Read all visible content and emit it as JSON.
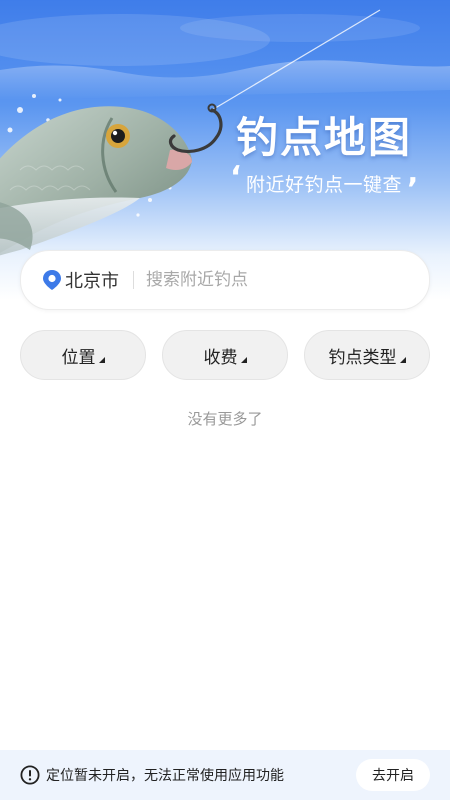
{
  "hero": {
    "title": "钓点地图",
    "subtitle": "附近好钓点一键查",
    "quote_open": "‘",
    "quote_close": "’"
  },
  "search": {
    "city": "北京市",
    "placeholder": "搜索附近钓点",
    "location_icon": "location-pin-icon"
  },
  "filters": [
    {
      "label": "位置"
    },
    {
      "label": "收费"
    },
    {
      "label": "钓点类型"
    }
  ],
  "list": {
    "empty_text": "没有更多了"
  },
  "notice": {
    "text": "定位暂未开启，无法正常使用应用功能",
    "button_label": "去开启",
    "icon": "alert-circle-icon"
  },
  "colors": {
    "accent": "#3f7dea",
    "pin": "#3d7ae8"
  }
}
